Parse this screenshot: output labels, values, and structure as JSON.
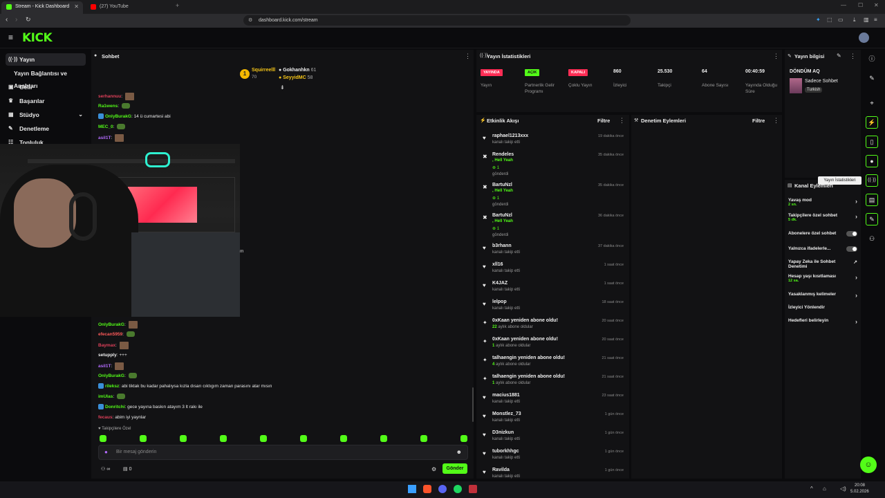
{
  "browser": {
    "tabs": [
      {
        "title": "Stream - Kick Dashboard",
        "color": "#53fc18"
      },
      {
        "title": "(27) YouTube",
        "color": "#ff0000"
      }
    ],
    "url": "dashboard.kick.com/stream"
  },
  "header": {
    "logo": "KICK"
  },
  "nav": {
    "items": [
      {
        "label": "Yayın",
        "icon": "broadcast-icon"
      },
      {
        "label": "Yayın Bağlantısı ve Anahtarı",
        "icon": ""
      },
      {
        "label": "Gelir",
        "icon": "money-icon"
      },
      {
        "label": "Başarılar",
        "icon": "trophy-icon"
      },
      {
        "label": "Stüdyo",
        "icon": "studio-icon"
      },
      {
        "label": "Denetleme",
        "icon": "wrench-icon"
      },
      {
        "label": "Topluluk",
        "icon": "community-icon"
      }
    ]
  },
  "chat": {
    "title": "Sohbet",
    "top_gifters": [
      {
        "rank": "1",
        "name": "Squirreelll",
        "count": "70"
      },
      {
        "name": "Gokhanhkn",
        "count": "61"
      },
      {
        "name": "SeyyidMC",
        "count": "58"
      }
    ],
    "messages_top": [
      {
        "user": "serhannuu",
        "text": "",
        "color": "#e0405a"
      },
      {
        "user": "Ra1wens",
        "text": "",
        "color": "#53fc18"
      },
      {
        "user": "OnlyBurakG",
        "text": "14 ü cumartesi abi",
        "color": "#53fc18"
      },
      {
        "user": "MEC_0",
        "text": "",
        "color": "#53fc18"
      },
      {
        "user": "asil1T",
        "text": "",
        "color": "#b46cff"
      }
    ],
    "messages_bottom": [
      {
        "user": "OnlyBurakG",
        "text": "",
        "color": "#53fc18"
      },
      {
        "user": "efecan5959",
        "text": "",
        "color": "#ff5a5a"
      },
      {
        "user": "Baymax",
        "text": "",
        "color": "#e0405a"
      },
      {
        "user": "setupply",
        "text": "+++",
        "color": "#eee"
      },
      {
        "user": "asil1T",
        "text": "",
        "color": "#b46cff"
      },
      {
        "user": "OnlyBurakG",
        "text": "",
        "color": "#53fc18"
      },
      {
        "user": "rileksz",
        "text": "abi tiktak bu kadar pahalıysa kızla dısarı cıktıgım zaman parasını atar mısın",
        "color": "#53fc18"
      },
      {
        "user": "imUlas",
        "text": "",
        "color": "#53fc18"
      },
      {
        "user": "Donritchi",
        "text": "gece yayına baskın atayım 3 lt rakı ile",
        "color": "#53fc18"
      },
      {
        "user": "fecaus",
        "text": "abim iyi yaynlar",
        "color": "#e0405a"
      }
    ],
    "followers_only": "Takipçilere Özel",
    "input_placeholder": "Bir mesaj gönderin",
    "viewer_icon_text": "∞",
    "count": "0",
    "send": "Gönder",
    "stray_text": "m"
  },
  "stats": {
    "title": "Yayın İstatistikleri",
    "items": [
      {
        "pill": "YAYINDA",
        "pill_color": "#ff2d55",
        "label": "Yayın"
      },
      {
        "pill": "AÇIK",
        "pill_color": "#53fc18",
        "label": "Partnerlik Gelir Programı"
      },
      {
        "pill": "KAPALI",
        "pill_color": "#ff2d55",
        "label": "Çoklu Yayın"
      },
      {
        "value": "860",
        "label": "İzleyici"
      },
      {
        "value": "25.530",
        "label": "Takipçi"
      },
      {
        "value": "64",
        "label": "Abone Sayısı"
      },
      {
        "value": "00:40:59",
        "label": "Yayında Olduğu Süre"
      }
    ]
  },
  "activity": {
    "title": "Etkinlik Akışı",
    "filter": "Filtre",
    "items": [
      {
        "name": "raphael1213xxx",
        "sub": "kanalı takip etti",
        "time": "19 dakika önce",
        "icon": "heart"
      },
      {
        "name": "Rendeles",
        "extra": ", Hell Yeah",
        "count": "1",
        "sub": "gönderdi",
        "time": "35 dakika önce",
        "icon": "kick"
      },
      {
        "name": "BartuNzl",
        "extra": ", Hell Yeah",
        "count": "1",
        "sub": "gönderdi",
        "time": "35 dakika önce",
        "icon": "kick"
      },
      {
        "name": "BartuNzl",
        "extra": ", Hell Yeah",
        "count": "1",
        "sub": "gönderdi",
        "time": "36 dakika önce",
        "icon": "kick"
      },
      {
        "name": "b3rhann",
        "sub": "kanalı takip etti",
        "time": "37 dakika önce",
        "icon": "heart"
      },
      {
        "name": "xll16",
        "sub": "kanalı takip etti",
        "time": "1 saat önce",
        "icon": "heart"
      },
      {
        "name": "K4JAZ",
        "sub": "kanalı takip etti",
        "time": "1 saat önce",
        "icon": "heart"
      },
      {
        "name": "lelpop",
        "sub": "kanalı takip etti",
        "time": "18 saat önce",
        "icon": "heart"
      },
      {
        "name": "0xKaan yeniden abone oldu!",
        "num": "22",
        "sub": "aylık abone oldular",
        "time": "20 saat önce",
        "icon": "star"
      },
      {
        "name": "0xKaan yeniden abone oldu!",
        "num": "1",
        "sub": "aylık abone oldular",
        "time": "20 saat önce",
        "icon": "star"
      },
      {
        "name": "talhaengin yeniden abone oldu!",
        "num": "4",
        "sub": "aylık abone oldular",
        "time": "21 saat önce",
        "icon": "star"
      },
      {
        "name": "talhaengin yeniden abone oldu!",
        "num": "1",
        "sub": "aylık abone oldular",
        "time": "21 saat önce",
        "icon": "star"
      },
      {
        "name": "macius1881",
        "sub": "kanalı takip etti",
        "time": "23 saat önce",
        "icon": "heart"
      },
      {
        "name": "Monstlez_73",
        "sub": "kanalı takip etti",
        "time": "1 gün önce",
        "icon": "heart"
      },
      {
        "name": "D3nizkun",
        "sub": "kanalı takip etti",
        "time": "1 gün önce",
        "icon": "heart"
      },
      {
        "name": "tuborkhhgc",
        "sub": "kanalı takip etti",
        "time": "1 gün önce",
        "icon": "heart"
      },
      {
        "name": "Ravilda",
        "sub": "kanalı takip etti",
        "time": "1 gün önce",
        "icon": "heart"
      }
    ]
  },
  "moderation": {
    "title": "Denetim Eylemleri",
    "filter": "Filtre"
  },
  "streaminfo": {
    "title": "Yayın bilgisi",
    "stream_title": "DÖNDÜM AQ",
    "category": "Sadece Sohbet",
    "language": "Turkish"
  },
  "tooltip": "Yayın İstatistikleri",
  "channel_actions": {
    "title": "Kanal Eylemleri",
    "items": [
      {
        "label": "Yavaş mod",
        "value": "2 sn.",
        "type": "arrow"
      },
      {
        "label": "Takipçilere özel sohbet",
        "value": "5 dk.",
        "type": "arrow"
      },
      {
        "label": "Abonelere özel sohbet",
        "value": "",
        "type": "toggle"
      },
      {
        "label": "Yalnızca ifadelerle...",
        "value": "",
        "type": "toggle"
      },
      {
        "label": "Yapay Zeka ile Sohbet Denetimi",
        "value": "",
        "type": "ext"
      },
      {
        "label": "Hesap yaşı kısıtlaması",
        "value": "12 sa.",
        "type": "arrow"
      },
      {
        "label": "Yasaklanmış kelimeler",
        "value": "",
        "type": "arrow"
      },
      {
        "label": "İzleyici Yönlendir",
        "value": "",
        "type": "none"
      },
      {
        "label": "Hedefleri belirleyin",
        "value": "",
        "type": "arrow"
      }
    ]
  },
  "taskbar": {
    "time": "20:08",
    "date": "5.02.2026"
  }
}
